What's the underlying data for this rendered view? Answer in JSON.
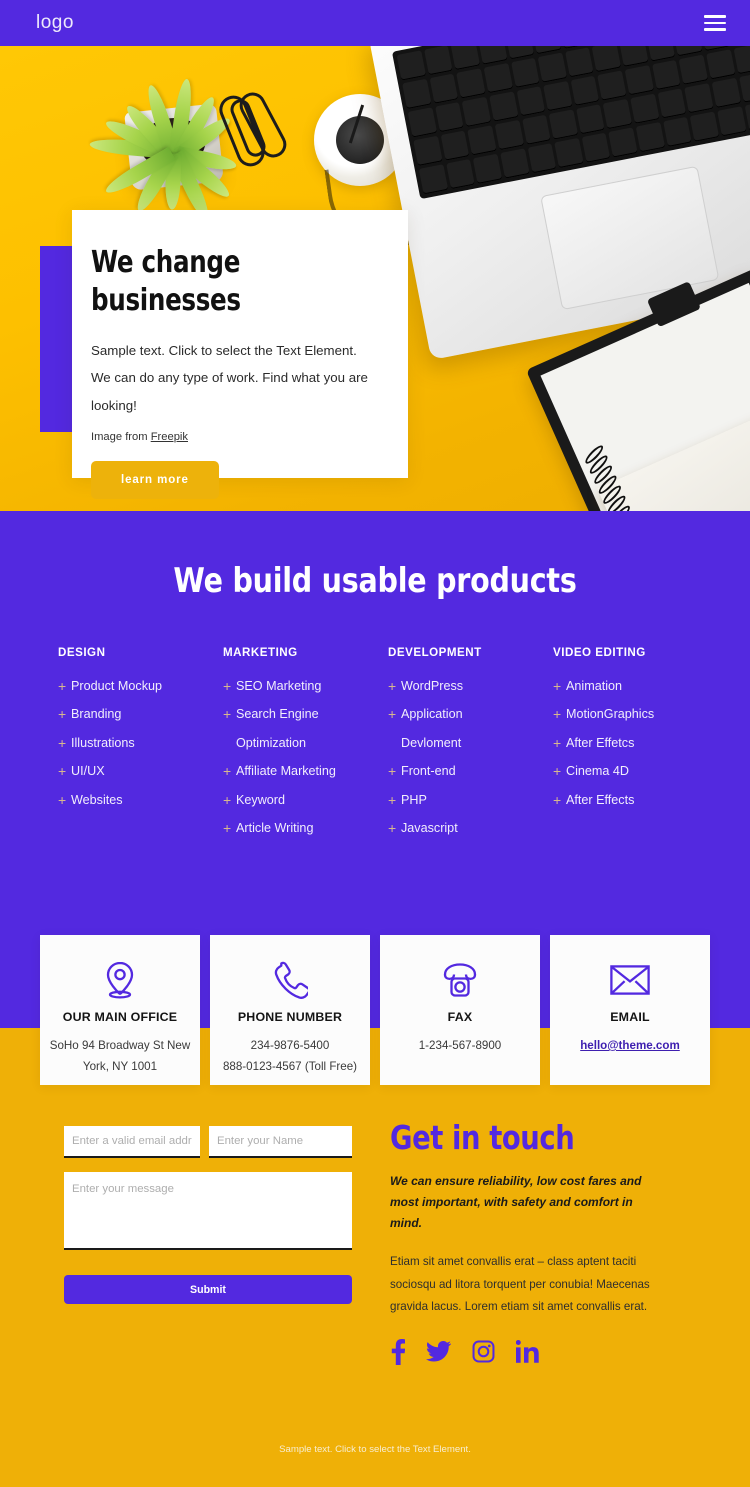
{
  "header": {
    "logo": "logo",
    "menu_icon": "hamburger-icon"
  },
  "hero": {
    "title": "We change\nbusinesses",
    "subtitle": "Sample text. Click to select the Text Element. We can do any type of work. Find what you are looking!",
    "credit_prefix": "Image from ",
    "credit_link": "Freepik",
    "cta": "learn more"
  },
  "services": {
    "heading": "We build usable products",
    "columns": [
      {
        "title": "DESIGN",
        "items": [
          {
            "label": "Product Mockup",
            "bullet": true
          },
          {
            "label": "Branding",
            "bullet": true
          },
          {
            "label": "Illustrations",
            "bullet": true
          },
          {
            "label": "UI/UX",
            "bullet": true
          },
          {
            "label": "Websites",
            "bullet": true
          }
        ]
      },
      {
        "title": "MARKETING",
        "items": [
          {
            "label": "SEO Marketing",
            "bullet": true
          },
          {
            "label": "Search Engine",
            "bullet": true
          },
          {
            "label": "Optimization",
            "bullet": false
          },
          {
            "label": "Affiliate Marketing",
            "bullet": true
          },
          {
            "label": "Keyword",
            "bullet": true
          },
          {
            "label": "Article Writing",
            "bullet": true
          }
        ]
      },
      {
        "title": "DEVELOPMENT",
        "items": [
          {
            "label": "WordPress",
            "bullet": true
          },
          {
            "label": "Application",
            "bullet": true
          },
          {
            "label": "Devloment",
            "bullet": false
          },
          {
            "label": "Front-end",
            "bullet": true
          },
          {
            "label": "PHP",
            "bullet": true
          },
          {
            "label": "Javascript",
            "bullet": true
          }
        ]
      },
      {
        "title": "VIDEO EDITING",
        "items": [
          {
            "label": "Animation",
            "bullet": true
          },
          {
            "label": "MotionGraphics",
            "bullet": true
          },
          {
            "label": "After Effetcs",
            "bullet": true
          },
          {
            "label": "Cinema 4D",
            "bullet": true
          },
          {
            "label": "After Effects",
            "bullet": true
          }
        ]
      }
    ],
    "bullet_symbol": "+"
  },
  "contact_cards": [
    {
      "icon": "map-pin-icon",
      "title": "OUR MAIN OFFICE",
      "lines": [
        "SoHo 94 Broadway St New",
        "York, NY 1001"
      ],
      "link": null
    },
    {
      "icon": "phone-icon",
      "title": "PHONE NUMBER",
      "lines": [
        "234-9876-5400",
        "888-0123-4567 (Toll Free)"
      ],
      "link": null
    },
    {
      "icon": "fax-icon",
      "title": "FAX",
      "lines": [
        "1-234-567-8900"
      ],
      "link": null
    },
    {
      "icon": "envelope-icon",
      "title": "EMAIL",
      "lines": [],
      "link": "hello@theme.com"
    }
  ],
  "form": {
    "email_placeholder": "Enter a valid email address",
    "email_value": "",
    "name_placeholder": "Enter your Name",
    "name_value": "",
    "message_placeholder": "Enter your message",
    "message_value": "",
    "submit_label": "Submit"
  },
  "get_in_touch": {
    "title": "Get in touch",
    "lead": "We can ensure reliability, low cost fares and most important, with safety and comfort in mind.",
    "body": "Etiam sit amet convallis erat – class aptent taciti sociosqu ad litora torquent per conubia! Maecenas gravida lacus. Lorem etiam sit amet convallis erat.",
    "socials": [
      "facebook-icon",
      "twitter-icon",
      "instagram-icon",
      "linkedin-icon"
    ]
  },
  "footer": {
    "note": "Sample text. Click to select the Text Element."
  },
  "colors": {
    "purple": "#5329E0",
    "yellow": "#EFB007",
    "hero_yellow": "#FFC000",
    "button_gold": "#EDB20B",
    "plus_tan": "#D8B88E"
  }
}
